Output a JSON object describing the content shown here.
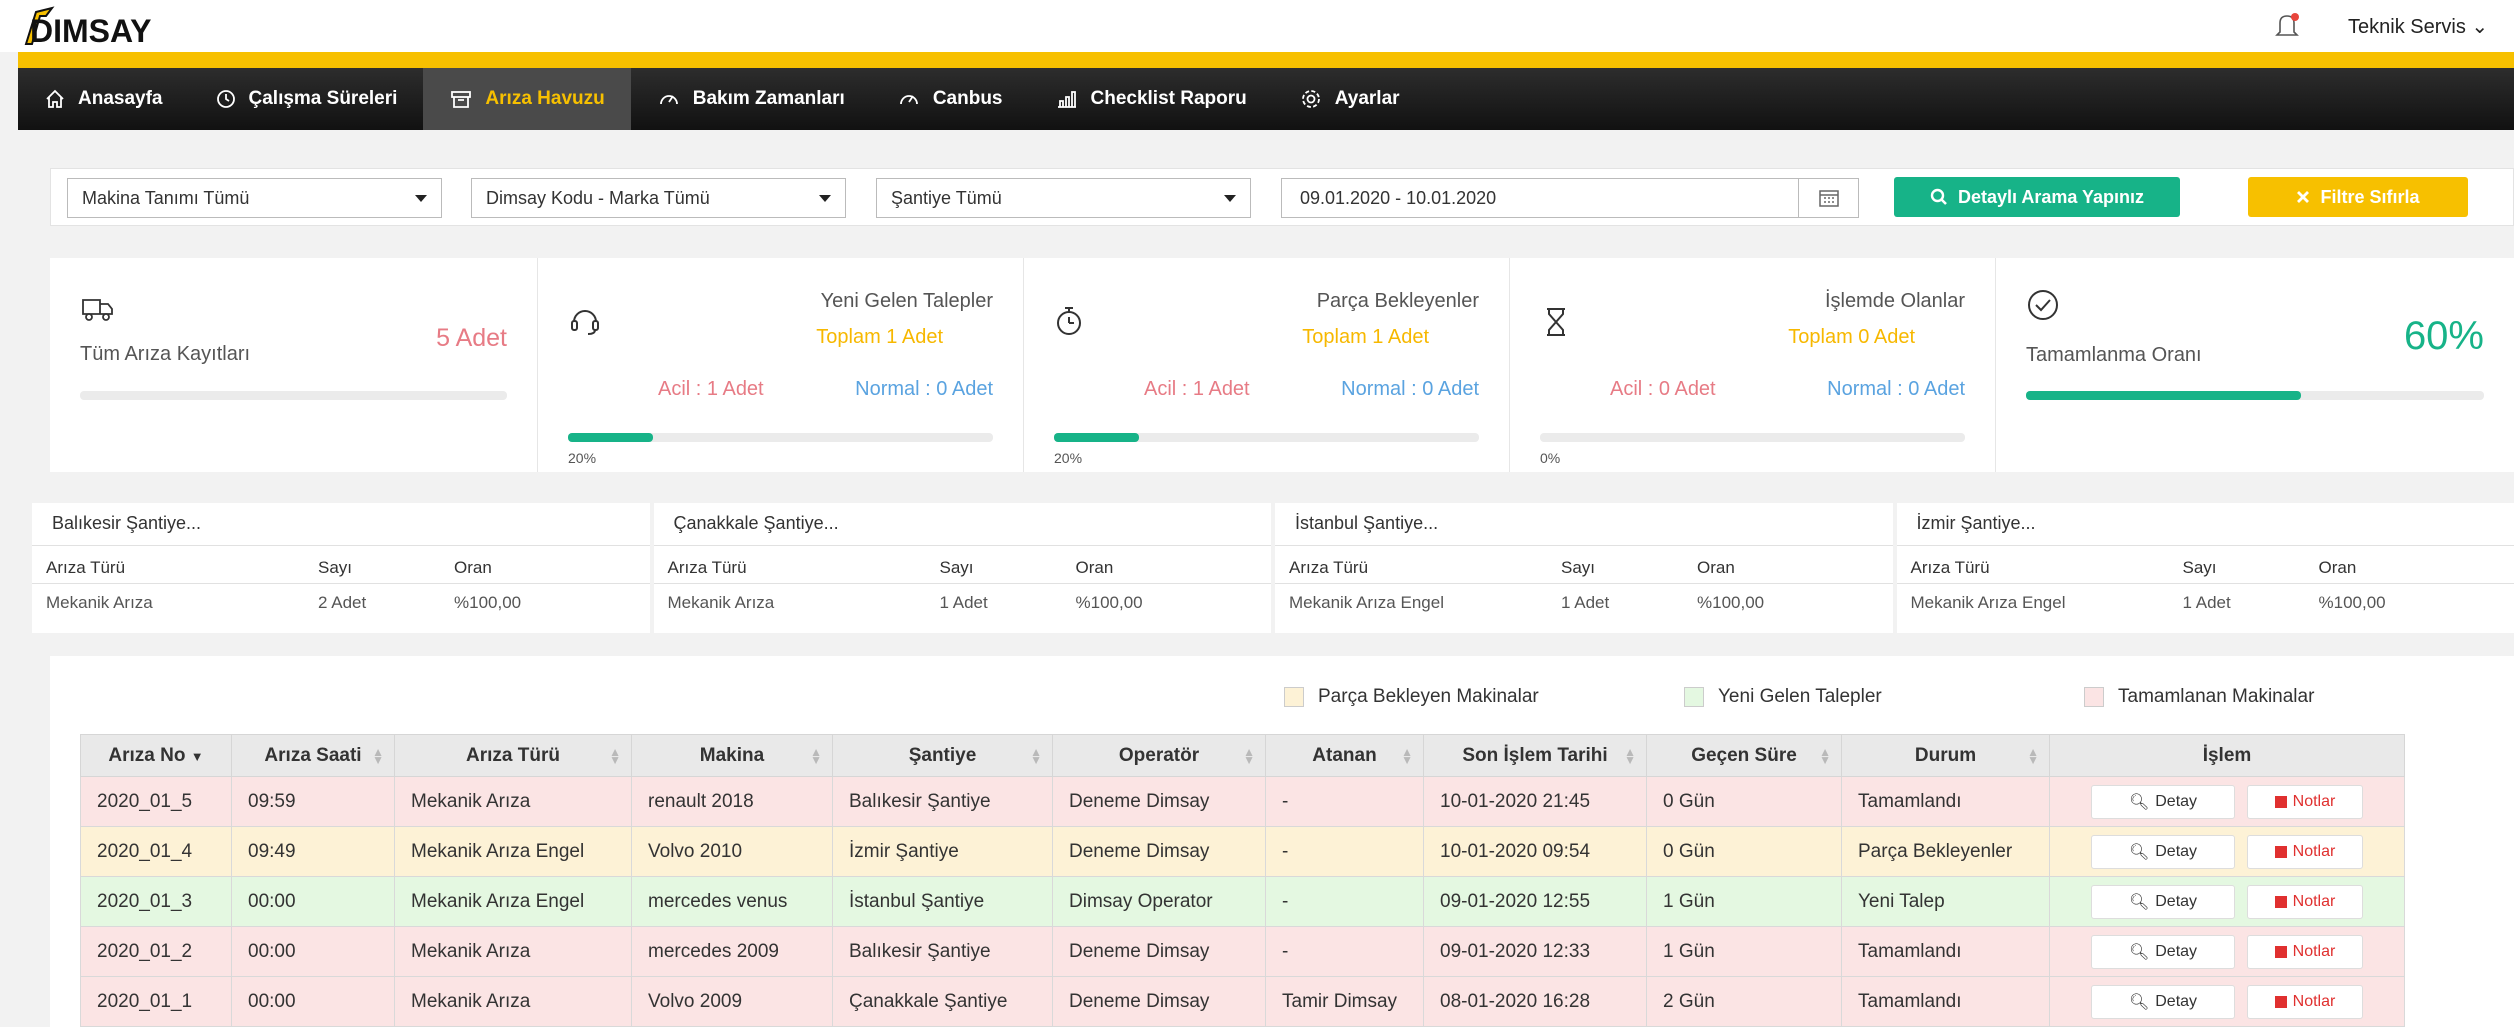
{
  "brand": {
    "name": "DIMSAY"
  },
  "header": {
    "user": "Teknik Servis",
    "user_caret": "⌄"
  },
  "nav": [
    {
      "label": "Anasayfa",
      "icon": "home-icon"
    },
    {
      "label": "Çalışma Süreleri",
      "icon": "clock-icon"
    },
    {
      "label": "Arıza Havuzu",
      "icon": "archive-icon",
      "active": true
    },
    {
      "label": "Bakım Zamanları",
      "icon": "gauge-icon"
    },
    {
      "label": "Canbus",
      "icon": "gauge-icon"
    },
    {
      "label": "Checklist Raporu",
      "icon": "bar-chart-icon"
    },
    {
      "label": "Ayarlar",
      "icon": "gear-icon"
    }
  ],
  "filters": {
    "machine": "Makina Tanımı Tümü",
    "code": "Dimsay Kodu - Marka Tümü",
    "site": "Şantiye Tümü",
    "date_range": "09.01.2020 - 10.01.2020",
    "search_button": "Detaylı Arama Yapınız",
    "reset_button": "Filtre Sıfırla"
  },
  "stats": {
    "all": {
      "title": "Tüm Arıza Kayıtları",
      "count": "5 Adet"
    },
    "new": {
      "title": "Yeni Gelen Talepler",
      "total": "Toplam 1 Adet",
      "urgent": "Acil : 1 Adet",
      "normal": "Normal : 0 Adet",
      "progress": 20,
      "progress_label": "20%"
    },
    "parts": {
      "title": "Parça Bekleyenler",
      "total": "Toplam 1 Adet",
      "urgent": "Acil : 1 Adet",
      "normal": "Normal : 0 Adet",
      "progress": 20,
      "progress_label": "20%"
    },
    "inprogress": {
      "title": "İşlemde Olanlar",
      "total": "Toplam 0 Adet",
      "urgent": "Acil : 0 Adet",
      "normal": "Normal : 0 Adet",
      "progress": 0,
      "progress_label": "0%"
    },
    "completion": {
      "title": "Tamamlanma Oranı",
      "value": "60%",
      "progress": 60
    }
  },
  "site_headers": {
    "type": "Arıza Türü",
    "count": "Sayı",
    "ratio": "Oran"
  },
  "sites": [
    {
      "name": "Balıkesir Şantiye...",
      "type": "Mekanik Arıza",
      "count": "2 Adet",
      "ratio": "%100,00"
    },
    {
      "name": "Çanakkale Şantiye...",
      "type": "Mekanik Arıza",
      "count": "1 Adet",
      "ratio": "%100,00"
    },
    {
      "name": "İstanbul Şantiye...",
      "type": "Mekanik Arıza Engel",
      "count": "1 Adet",
      "ratio": "%100,00"
    },
    {
      "name": "İzmir Şantiye...",
      "type": "Mekanik Arıza Engel",
      "count": "1 Adet",
      "ratio": "%100,00"
    }
  ],
  "legend": {
    "parts": {
      "label": "Parça Bekleyen Makinalar",
      "color": "#fdf2d6"
    },
    "new": {
      "label": "Yeni Gelen Talepler",
      "color": "#e4f8e1"
    },
    "done": {
      "label": "Tamamlanan Makinalar",
      "color": "#fbe4e4"
    }
  },
  "table": {
    "columns": [
      "Arıza No",
      "Arıza Saati",
      "Arıza Türü",
      "Makina",
      "Şantiye",
      "Operatör",
      "Atanan",
      "Son İşlem Tarihi",
      "Geçen Süre",
      "Durum",
      "İşlem"
    ],
    "detail_label": "Detay",
    "notes_label": "Notlar",
    "rows": [
      {
        "status_color": "red",
        "cells": [
          "2020_01_5",
          "09:59",
          "Mekanik Arıza",
          "renault 2018",
          "Balıkesir Şantiye",
          "Deneme Dimsay",
          "-",
          "10-01-2020 21:45",
          "0 Gün",
          "Tamamlandı"
        ]
      },
      {
        "status_color": "yel",
        "cells": [
          "2020_01_4",
          "09:49",
          "Mekanik Arıza Engel",
          "Volvo 2010",
          "İzmir Şantiye",
          "Deneme Dimsay",
          "-",
          "10-01-2020 09:54",
          "0 Gün",
          "Parça Bekleyenler"
        ]
      },
      {
        "status_color": "grn",
        "cells": [
          "2020_01_3",
          "00:00",
          "Mekanik Arıza Engel",
          "mercedes venus",
          "İstanbul Şantiye",
          "Dimsay Operator",
          "-",
          "09-01-2020 12:55",
          "1 Gün",
          "Yeni Talep"
        ]
      },
      {
        "status_color": "red",
        "cells": [
          "2020_01_2",
          "00:00",
          "Mekanik Arıza",
          "mercedes 2009",
          "Balıkesir Şantiye",
          "Deneme Dimsay",
          "-",
          "09-01-2020 12:33",
          "1 Gün",
          "Tamamlandı"
        ]
      },
      {
        "status_color": "red",
        "cells": [
          "2020_01_1",
          "00:00",
          "Mekanik Arıza",
          "Volvo 2009",
          "Çanakkale Şantiye",
          "Deneme Dimsay",
          "Tamir Dimsay",
          "08-01-2020 16:28",
          "2 Gün",
          "Tamamlandı"
        ]
      }
    ]
  }
}
